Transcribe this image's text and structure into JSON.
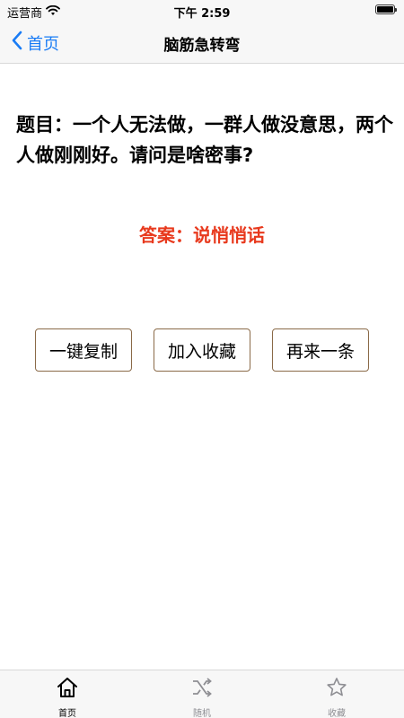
{
  "status_bar": {
    "carrier": "运营商",
    "time": "下午 2:59"
  },
  "nav": {
    "back_label": "首页",
    "title": "脑筋急转弯"
  },
  "content": {
    "question": "题目：一个人无法做，一群人做没意思，两个人做刚刚好。请问是啥密事?",
    "answer": "答案：说悄悄话"
  },
  "actions": {
    "copy_label": "一键复制",
    "favorite_label": "加入收藏",
    "next_label": "再来一条"
  },
  "tabs": [
    {
      "label": "首页",
      "icon": "home-icon",
      "selected": true
    },
    {
      "label": "随机",
      "icon": "shuffle-icon",
      "selected": false
    },
    {
      "label": "收藏",
      "icon": "star-icon",
      "selected": false
    }
  ],
  "colors": {
    "accent": "#1a7cf5",
    "answer": "#e8391d",
    "button_border": "#8a6a48"
  }
}
